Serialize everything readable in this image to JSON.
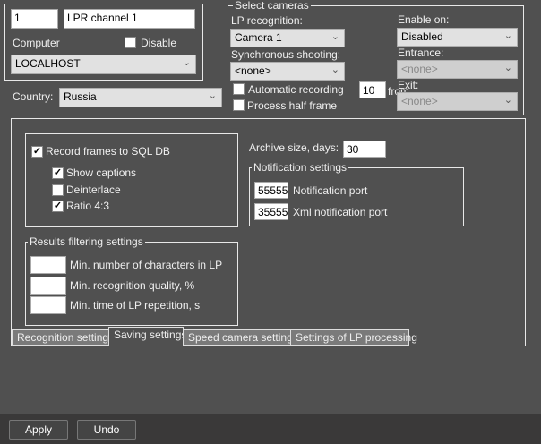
{
  "channel": {
    "id": "1",
    "name": "LPR channel  1",
    "computer_label": "Computer",
    "disable_label": "Disable",
    "disable_checked": false,
    "computer_value": "LOCALHOST"
  },
  "country": {
    "label": "Country:",
    "value": "Russia"
  },
  "cameras": {
    "legend": "Select cameras",
    "lp_label": "LP recognition:",
    "lp_value": "Camera 1",
    "sync_label": "Synchronous shooting:",
    "sync_value": "<none>",
    "auto_label": "Automatic recording",
    "auto_checked": false,
    "half_label": "Process half frame",
    "half_checked": false,
    "from_value": "10",
    "from_label": "from",
    "enable_label": "Enable on:",
    "enable_value": "Disabled",
    "entrance_label": "Entrance:",
    "entrance_value": "<none>",
    "exit_label": "Exit:",
    "exit_value": "<none>"
  },
  "saving": {
    "record_label": "Record frames to SQL DB",
    "record_checked": true,
    "captions_label": "Show captions",
    "captions_checked": true,
    "deinterlace_label": "Deinterlace",
    "deinterlace_checked": false,
    "ratio_label": "Ratio 4:3",
    "ratio_checked": true,
    "archive_label": "Archive size, days:",
    "archive_value": "30"
  },
  "notification": {
    "legend": "Notification settings",
    "port_value": "55555",
    "port_label": "Notification port",
    "xml_value": "35555",
    "xml_label": "Xml notification port"
  },
  "filter": {
    "legend": "Results filtering settings",
    "chars_label": "Min. number of characters in LP",
    "chars_value": "",
    "quality_label": "Min. recognition quality, %",
    "quality_value": "",
    "time_label": "Min. time of LP repetition, s",
    "time_value": ""
  },
  "tabs": [
    "Recognition settings",
    "Saving settings",
    "Speed camera settings",
    "Settings of LP processing"
  ],
  "active_tab": "Saving settings",
  "buttons": {
    "apply": "Apply",
    "undo": "Undo"
  }
}
